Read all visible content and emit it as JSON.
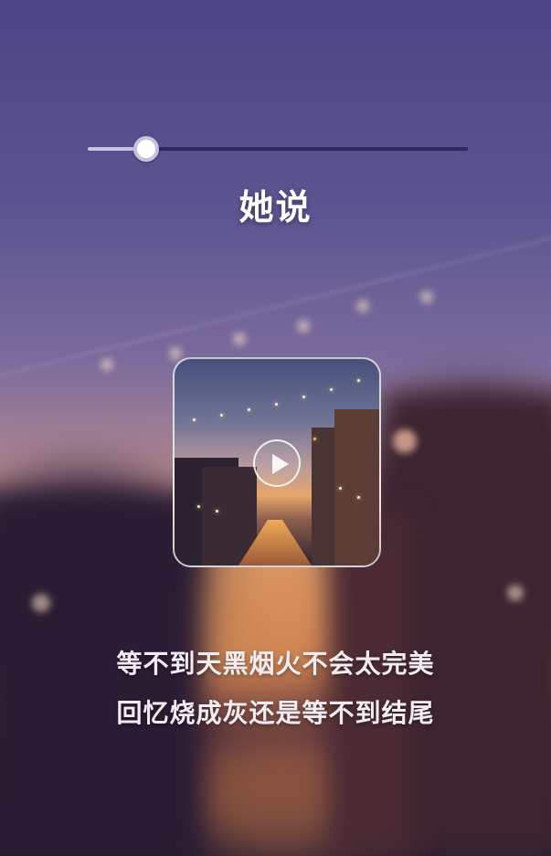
{
  "player": {
    "song_title": "她说",
    "progress": 0.155,
    "lyrics": [
      "等不到天黑烟火不会太完美",
      "回忆烧成灰还是等不到结尾"
    ]
  },
  "colors": {
    "track": "#2c2a5e",
    "track_fill": "#c9c4e0",
    "thumb": "#ffffff",
    "title_text": "#ffffff"
  },
  "icons": {
    "play": "play-icon"
  }
}
